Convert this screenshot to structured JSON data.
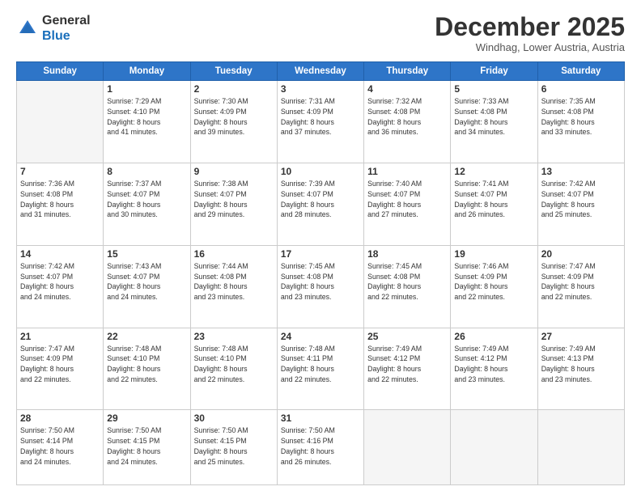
{
  "header": {
    "logo_general": "General",
    "logo_blue": "Blue",
    "month_title": "December 2025",
    "location": "Windhag, Lower Austria, Austria"
  },
  "days_of_week": [
    "Sunday",
    "Monday",
    "Tuesday",
    "Wednesday",
    "Thursday",
    "Friday",
    "Saturday"
  ],
  "weeks": [
    [
      {
        "day": "",
        "info": ""
      },
      {
        "day": "1",
        "info": "Sunrise: 7:29 AM\nSunset: 4:10 PM\nDaylight: 8 hours\nand 41 minutes."
      },
      {
        "day": "2",
        "info": "Sunrise: 7:30 AM\nSunset: 4:09 PM\nDaylight: 8 hours\nand 39 minutes."
      },
      {
        "day": "3",
        "info": "Sunrise: 7:31 AM\nSunset: 4:09 PM\nDaylight: 8 hours\nand 37 minutes."
      },
      {
        "day": "4",
        "info": "Sunrise: 7:32 AM\nSunset: 4:08 PM\nDaylight: 8 hours\nand 36 minutes."
      },
      {
        "day": "5",
        "info": "Sunrise: 7:33 AM\nSunset: 4:08 PM\nDaylight: 8 hours\nand 34 minutes."
      },
      {
        "day": "6",
        "info": "Sunrise: 7:35 AM\nSunset: 4:08 PM\nDaylight: 8 hours\nand 33 minutes."
      }
    ],
    [
      {
        "day": "7",
        "info": "Sunrise: 7:36 AM\nSunset: 4:08 PM\nDaylight: 8 hours\nand 31 minutes."
      },
      {
        "day": "8",
        "info": "Sunrise: 7:37 AM\nSunset: 4:07 PM\nDaylight: 8 hours\nand 30 minutes."
      },
      {
        "day": "9",
        "info": "Sunrise: 7:38 AM\nSunset: 4:07 PM\nDaylight: 8 hours\nand 29 minutes."
      },
      {
        "day": "10",
        "info": "Sunrise: 7:39 AM\nSunset: 4:07 PM\nDaylight: 8 hours\nand 28 minutes."
      },
      {
        "day": "11",
        "info": "Sunrise: 7:40 AM\nSunset: 4:07 PM\nDaylight: 8 hours\nand 27 minutes."
      },
      {
        "day": "12",
        "info": "Sunrise: 7:41 AM\nSunset: 4:07 PM\nDaylight: 8 hours\nand 26 minutes."
      },
      {
        "day": "13",
        "info": "Sunrise: 7:42 AM\nSunset: 4:07 PM\nDaylight: 8 hours\nand 25 minutes."
      }
    ],
    [
      {
        "day": "14",
        "info": "Sunrise: 7:42 AM\nSunset: 4:07 PM\nDaylight: 8 hours\nand 24 minutes."
      },
      {
        "day": "15",
        "info": "Sunrise: 7:43 AM\nSunset: 4:07 PM\nDaylight: 8 hours\nand 24 minutes."
      },
      {
        "day": "16",
        "info": "Sunrise: 7:44 AM\nSunset: 4:08 PM\nDaylight: 8 hours\nand 23 minutes."
      },
      {
        "day": "17",
        "info": "Sunrise: 7:45 AM\nSunset: 4:08 PM\nDaylight: 8 hours\nand 23 minutes."
      },
      {
        "day": "18",
        "info": "Sunrise: 7:45 AM\nSunset: 4:08 PM\nDaylight: 8 hours\nand 22 minutes."
      },
      {
        "day": "19",
        "info": "Sunrise: 7:46 AM\nSunset: 4:09 PM\nDaylight: 8 hours\nand 22 minutes."
      },
      {
        "day": "20",
        "info": "Sunrise: 7:47 AM\nSunset: 4:09 PM\nDaylight: 8 hours\nand 22 minutes."
      }
    ],
    [
      {
        "day": "21",
        "info": "Sunrise: 7:47 AM\nSunset: 4:09 PM\nDaylight: 8 hours\nand 22 minutes."
      },
      {
        "day": "22",
        "info": "Sunrise: 7:48 AM\nSunset: 4:10 PM\nDaylight: 8 hours\nand 22 minutes."
      },
      {
        "day": "23",
        "info": "Sunrise: 7:48 AM\nSunset: 4:10 PM\nDaylight: 8 hours\nand 22 minutes."
      },
      {
        "day": "24",
        "info": "Sunrise: 7:48 AM\nSunset: 4:11 PM\nDaylight: 8 hours\nand 22 minutes."
      },
      {
        "day": "25",
        "info": "Sunrise: 7:49 AM\nSunset: 4:12 PM\nDaylight: 8 hours\nand 22 minutes."
      },
      {
        "day": "26",
        "info": "Sunrise: 7:49 AM\nSunset: 4:12 PM\nDaylight: 8 hours\nand 23 minutes."
      },
      {
        "day": "27",
        "info": "Sunrise: 7:49 AM\nSunset: 4:13 PM\nDaylight: 8 hours\nand 23 minutes."
      }
    ],
    [
      {
        "day": "28",
        "info": "Sunrise: 7:50 AM\nSunset: 4:14 PM\nDaylight: 8 hours\nand 24 minutes."
      },
      {
        "day": "29",
        "info": "Sunrise: 7:50 AM\nSunset: 4:15 PM\nDaylight: 8 hours\nand 24 minutes."
      },
      {
        "day": "30",
        "info": "Sunrise: 7:50 AM\nSunset: 4:15 PM\nDaylight: 8 hours\nand 25 minutes."
      },
      {
        "day": "31",
        "info": "Sunrise: 7:50 AM\nSunset: 4:16 PM\nDaylight: 8 hours\nand 26 minutes."
      },
      {
        "day": "",
        "info": ""
      },
      {
        "day": "",
        "info": ""
      },
      {
        "day": "",
        "info": ""
      }
    ]
  ]
}
